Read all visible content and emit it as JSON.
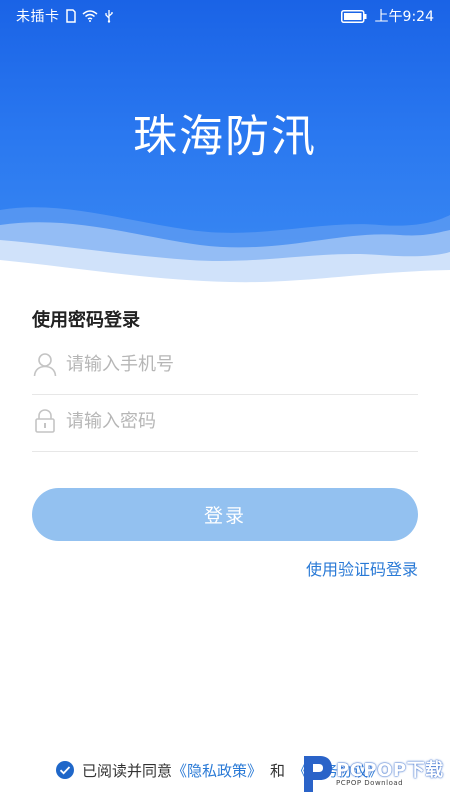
{
  "status_bar": {
    "carrier": "未插卡",
    "time": "上午9:24",
    "icons": [
      "sim-card-icon",
      "wifi-icon",
      "usb-icon",
      "battery-icon"
    ]
  },
  "header": {
    "title": "珠海防汛"
  },
  "login_form": {
    "heading": "使用密码登录",
    "phone": {
      "value": "",
      "placeholder": "请输入手机号",
      "icon": "user-icon"
    },
    "password": {
      "value": "",
      "placeholder": "请输入密码",
      "icon": "lock-icon"
    },
    "submit_label": "登录",
    "alt_login_link": "使用验证码登录"
  },
  "agreement": {
    "checked": true,
    "prefix": "已阅读并同意",
    "privacy_link": "《隐私政策》",
    "conjunction": "和",
    "service_link": "《服务协议》"
  },
  "watermark": {
    "text": "PCPOP下载",
    "subtext": "PCPOP Download"
  },
  "colors": {
    "header_blue": "#1a63e6",
    "button_disabled": "#93c1f0",
    "link_blue": "#2a7ad6",
    "placeholder_gray": "#b6b6b6"
  }
}
